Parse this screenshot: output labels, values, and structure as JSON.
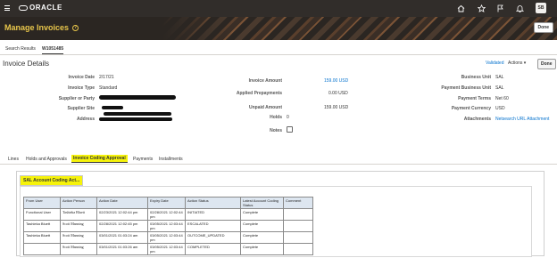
{
  "global_header": {
    "brand": "ORACLE",
    "icons": [
      "home-icon",
      "star-icon",
      "flag-icon",
      "bell-icon"
    ],
    "user_initials": "SB"
  },
  "banner": {
    "title": "Manage Invoices",
    "done_label": "Done"
  },
  "page_tabs": [
    {
      "label": "Search Results",
      "active": false
    },
    {
      "label": "W1051485",
      "active": true
    }
  ],
  "invoice_details": {
    "title": "Invoice Details",
    "validated_label": "Validated",
    "actions_label": "Actions ▾",
    "done_label": "Done",
    "left_fields": [
      {
        "label": "Invoice Date",
        "value": "2/17/21"
      },
      {
        "label": "Invoice Type",
        "value": "Standard"
      },
      {
        "label": "Supplier or Party",
        "value": ""
      },
      {
        "label": "Supplier Site",
        "value": ""
      },
      {
        "label": "Address",
        "value": ""
      }
    ],
    "middle_fields": [
      {
        "label": "Invoice Amount",
        "value": "159.00 USD",
        "link": true
      },
      {
        "label": "Applied Prepayments",
        "value": "0.00 USD",
        "link": false
      },
      {
        "label": "Unpaid Amount",
        "value": "159.00 USD",
        "link": false
      },
      {
        "label": "Holds",
        "value": "0",
        "link": false
      },
      {
        "label": "Notes",
        "value": "",
        "link": false
      }
    ],
    "right_fields": [
      {
        "label": "Business Unit",
        "value": "SAL",
        "link": false
      },
      {
        "label": "Payment Business Unit",
        "value": "SAL",
        "link": false
      },
      {
        "label": "Payment Terms",
        "value": "Net 60",
        "link": false
      },
      {
        "label": "Payment Currency",
        "value": "USD",
        "link": false
      },
      {
        "label": "Attachments",
        "value": "Netsearch URL Attachment",
        "link": true
      }
    ]
  },
  "sub_tabs": [
    {
      "label": "Lines",
      "active": false
    },
    {
      "label": "Holds and Approvals",
      "active": false
    },
    {
      "label": "Invoice Coding Approval",
      "active": true
    },
    {
      "label": "Payments",
      "active": false
    },
    {
      "label": "Installments",
      "active": false
    }
  ],
  "panel": {
    "tab_label": "SAL Account Coding Act...",
    "columns": [
      "From User",
      "Action Person",
      "Action Date",
      "Expiry Date",
      "Action Status",
      "Latest Account Coding Status",
      "Comment"
    ],
    "rows": [
      [
        "Functional User",
        "Tashieka Bluett",
        "02/23/2021 12:02:44 pm",
        "02/28/2021 12:02:44 pm",
        "INITIATED",
        "Complete",
        ""
      ],
      [
        "Tashieka Bluett",
        "Scott Manning",
        "02/28/2021 12:02:45 pm",
        "03/05/2021 12:03:44 pm",
        "ESCALATED",
        "Complete",
        ""
      ],
      [
        "Tashieka Bluett",
        "Scott Manning",
        "03/01/2021 01:03:24 am",
        "03/05/2021 12:03:44 pm",
        "OUTCOME_UPDATED",
        "Complete",
        ""
      ],
      [
        "",
        "Scott Manning",
        "03/01/2021 01:03:26 am",
        "03/05/2021 12:03:44 pm",
        "COMPLETED",
        "Complete",
        ""
      ]
    ]
  }
}
